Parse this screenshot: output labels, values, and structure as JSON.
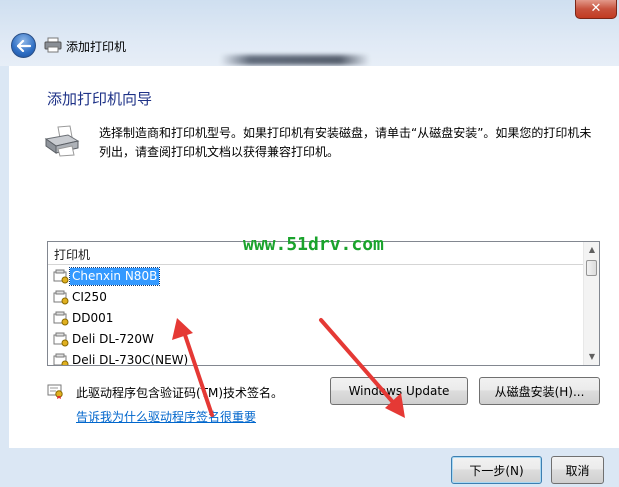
{
  "window": {
    "title": "添加打印机",
    "close_glyph": "✕"
  },
  "wizard": {
    "heading": "添加打印机向导",
    "description": "选择制造商和打印机型号。如果打印机有安装磁盘，请单击“从磁盘安装”。如果您的打印机未列出，请查阅打印机文档以获得兼容打印机。"
  },
  "printer_list": {
    "header": "打印机",
    "items": [
      {
        "label": "Chenxin N80B",
        "selected": true
      },
      {
        "label": "CI250",
        "selected": false
      },
      {
        "label": "DD001",
        "selected": false
      },
      {
        "label": "Deli DL-720W",
        "selected": false
      },
      {
        "label": "Deli DL-730C(NEW)",
        "selected": false
      }
    ]
  },
  "watermark": "www.51drv.com",
  "signature": {
    "text": "此驱动程序包含验证码(TM)技术签名。",
    "link": "告诉我为什么驱动程序签名很重要"
  },
  "buttons": {
    "windows_update": "Windows Update",
    "have_disk": "从磁盘安装(H)...",
    "next": "下一步(N)",
    "cancel": "取消"
  },
  "icons": {
    "back": "back-arrow-icon",
    "title_printer": "printer-icon",
    "wizard_printer": "printer-icon",
    "list_item": "certified-driver-icon",
    "signature": "certificate-icon"
  },
  "colors": {
    "heading": "#1e3287",
    "link": "#0066cc",
    "selection": "#3399ff",
    "watermark": "#1aa32c",
    "annotation_arrow": "#e53935"
  }
}
